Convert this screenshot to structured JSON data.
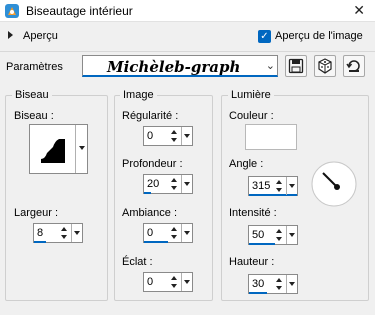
{
  "window": {
    "title": "Biseautage intérieur",
    "close_glyph": "✕"
  },
  "preview": {
    "label": "Aperçu",
    "checkbox_label": "Aperçu de l'image",
    "checked": true
  },
  "params": {
    "label": "Paramètres",
    "preset_value": "Michèleb-graph"
  },
  "bevel": {
    "title": "Biseau",
    "bevel_label": "Biseau :",
    "width_label": "Largeur :",
    "width_value": "8"
  },
  "image": {
    "title": "Image",
    "smoothness_label": "Régularité :",
    "smoothness_value": "0",
    "depth_label": "Profondeur :",
    "depth_value": "20",
    "ambience_label": "Ambiance :",
    "ambience_value": "0",
    "shininess_label": "Éclat :",
    "shininess_value": "0"
  },
  "light": {
    "title": "Lumière",
    "color_label": "Couleur :",
    "color": "#ffffff",
    "angle_label": "Angle :",
    "angle_value": "315",
    "intensity_label": "Intensité :",
    "intensity_value": "50",
    "elevation_label": "Hauteur :",
    "elevation_value": "30"
  },
  "colors": {
    "accent": "#0067c0"
  },
  "icons": [
    "app-icon",
    "close-icon",
    "expand-arrow-icon",
    "check-icon",
    "save-icon",
    "dice-icon",
    "reset-icon",
    "bevel-shape-icon",
    "angle-dial-icon"
  ]
}
